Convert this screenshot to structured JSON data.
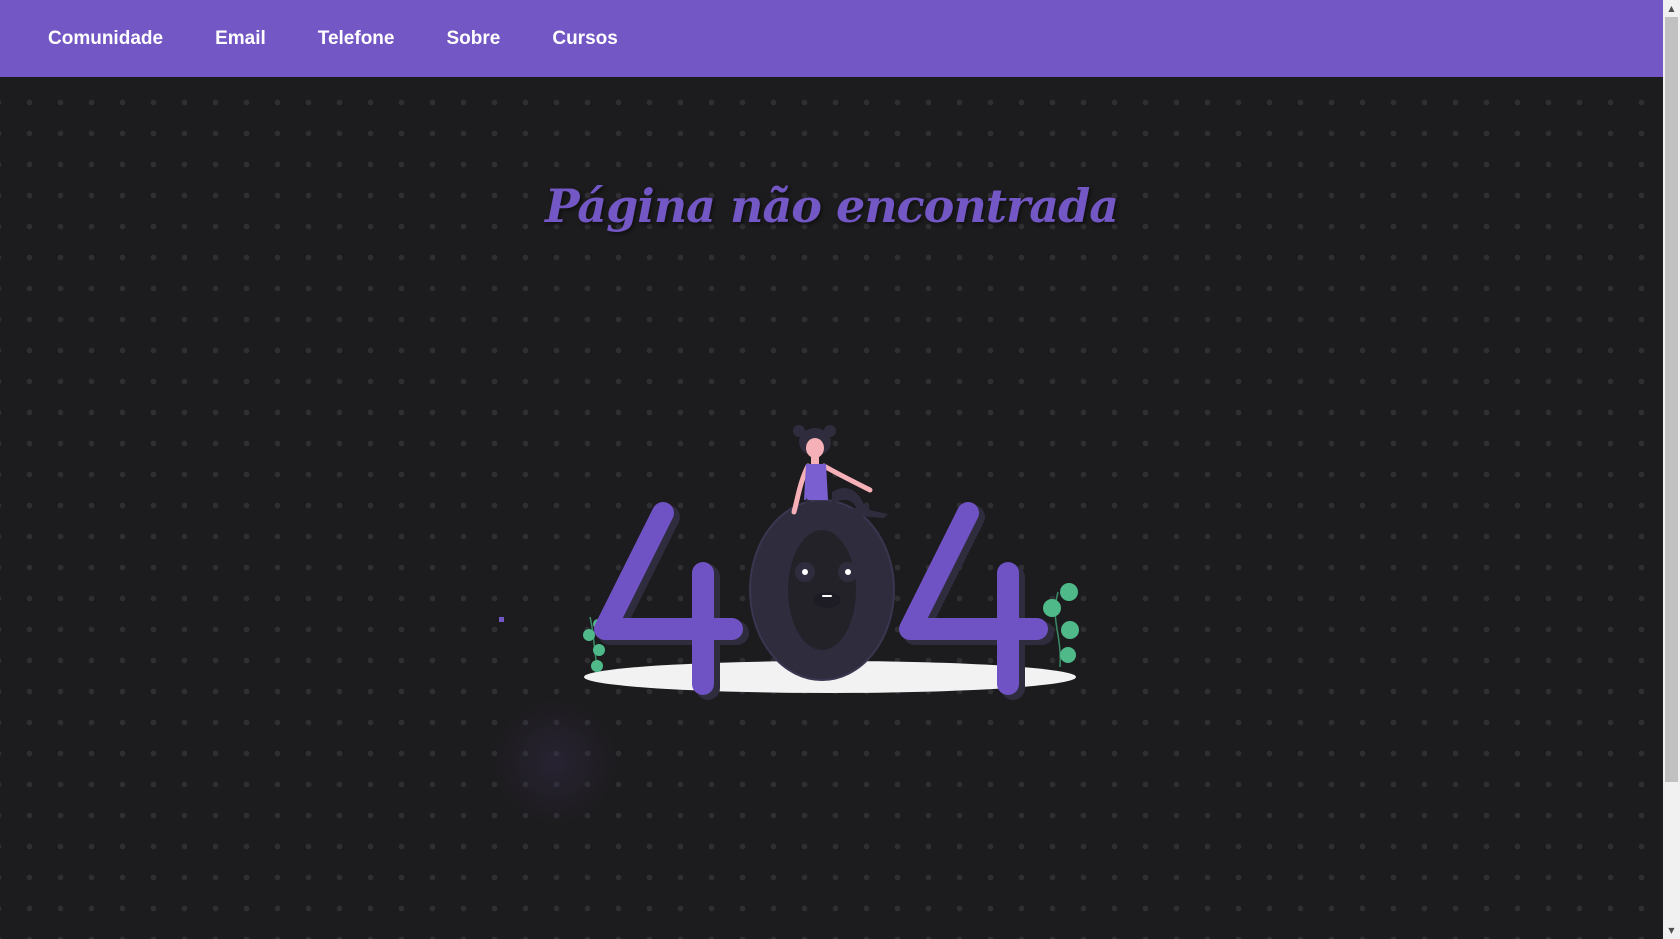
{
  "nav": {
    "links": [
      {
        "label": "Comunidade"
      },
      {
        "label": "Email"
      },
      {
        "label": "Telefone"
      },
      {
        "label": "Sobre"
      },
      {
        "label": "Cursos"
      }
    ]
  },
  "main": {
    "title": "Página não encontrada"
  },
  "illustration": {
    "digits": [
      "4",
      "0",
      "4"
    ],
    "icon": "404-illustration"
  },
  "colors": {
    "accent": "#7357c4",
    "background": "#1c1b1d",
    "dots": "#2f2e33",
    "zero": "#2f2c3e",
    "ellipse": "#f2f2f2",
    "plant": "#4fb98a"
  }
}
